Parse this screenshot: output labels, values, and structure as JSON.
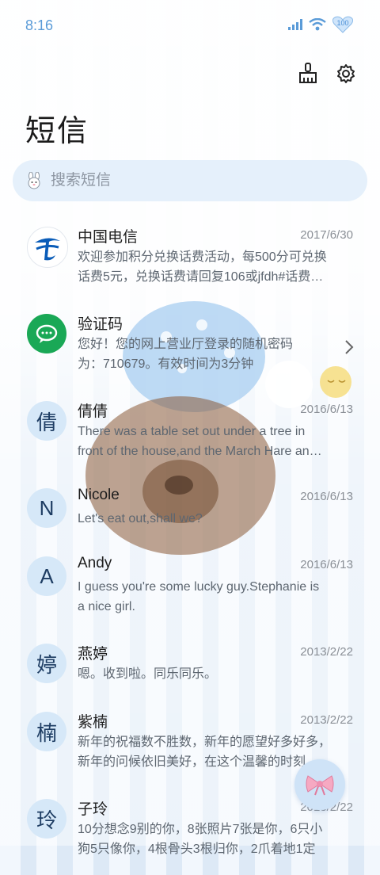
{
  "status_bar": {
    "time": "8:16",
    "battery": "100"
  },
  "page_title": "短信",
  "search": {
    "placeholder": "搜索短信"
  },
  "conversations": [
    {
      "avatar": "",
      "name": "中国电信",
      "date": "2017/6/30",
      "preview": [
        "欢迎参加积分兑换话费活动，每500分可兑换",
        "话费5元，兑换话费请回复106或jfdh#话费…"
      ]
    },
    {
      "avatar": "",
      "name": "验证码",
      "date": "",
      "preview": [
        "您好！您的网上营业厅登录的随机密码",
        "为：710679。有效时间为3分钟"
      ]
    },
    {
      "avatar": "倩",
      "name": "倩倩",
      "date": "2016/6/13",
      "preview": [
        "There was a table set out under a tree in",
        "front of the house,and the March Hare an…"
      ]
    },
    {
      "avatar": "N",
      "name": "Nicole",
      "date": "2016/6/13",
      "preview": [
        "Let's eat out,shall we?",
        ""
      ]
    },
    {
      "avatar": "A",
      "name": "Andy",
      "date": "2016/6/13",
      "preview": [
        "I guess you're some lucky guy.Stephanie is",
        "a nice girl."
      ]
    },
    {
      "avatar": "婷",
      "name": "燕婷",
      "date": "2013/2/22",
      "preview": [
        "嗯。收到啦。同乐同乐。",
        ""
      ]
    },
    {
      "avatar": "楠",
      "name": "紫楠",
      "date": "2013/2/22",
      "preview": [
        "新年的祝福数不胜数，新年的愿望好多好多，",
        "新年的问候依旧美好，在这个温馨的时刻，…"
      ]
    },
    {
      "avatar": "玲",
      "name": "子玲",
      "date": "2013/2/22",
      "preview": [
        "10分想念9别的你，8张照片7张是你，6只小",
        "狗5只像你，4根骨头3根归你，2爪着地1定"
      ]
    }
  ],
  "icons": {
    "signal": "signal-icon",
    "wifi": "wifi-icon",
    "battery": "battery-icon",
    "clean": "brush-clean-icon",
    "settings": "gear-icon",
    "search": "bunny-search-icon",
    "chevron": "chevron-right-icon",
    "fab": "bow-compose-icon"
  },
  "colors": {
    "accent": "#5a9bd8",
    "telecom_blue": "#0a5cb8",
    "sms_green": "#1aa856",
    "avatar_bg": "#d6e8f8"
  }
}
